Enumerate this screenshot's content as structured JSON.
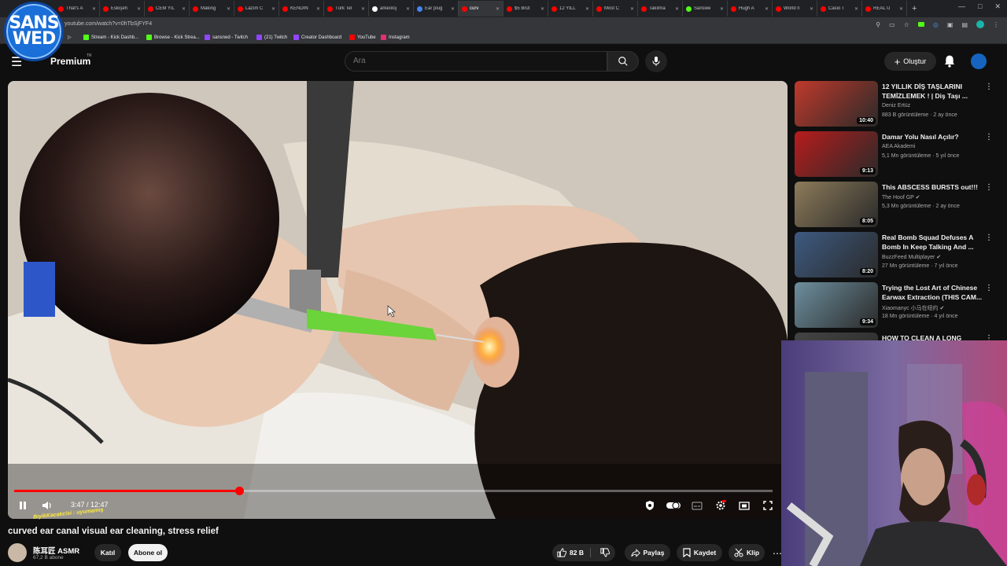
{
  "browser": {
    "tabs": [
      {
        "label": "That's A",
        "color": "#ff0000",
        "active": false
      },
      {
        "label": "Eskişeh",
        "color": "#ff0000",
        "active": false
      },
      {
        "label": "CEM YIL",
        "color": "#ff0000",
        "active": false
      },
      {
        "label": "Making",
        "color": "#ff0000",
        "active": false
      },
      {
        "label": "Lazım C",
        "color": "#ff0000",
        "active": false
      },
      {
        "label": "KENDİN",
        "color": "#ff0000",
        "active": false
      },
      {
        "label": "Türk Tel",
        "color": "#ff0000",
        "active": false
      },
      {
        "label": "arkeoloj",
        "color": "#ffffff",
        "active": false
      },
      {
        "label": "Ear plug",
        "color": "#4285f4",
        "active": false
      },
      {
        "label": "curv",
        "color": "#ff0000",
        "active": true
      },
      {
        "label": "$5 Brut",
        "color": "#ff0000",
        "active": false
      },
      {
        "label": "12 YILL",
        "color": "#ff0000",
        "active": false
      },
      {
        "label": "Most C",
        "color": "#ff0000",
        "active": false
      },
      {
        "label": "Takılma",
        "color": "#ff0000",
        "active": false
      },
      {
        "label": "Sanswe",
        "color": "#53fc18",
        "active": false
      },
      {
        "label": "Hugh A",
        "color": "#ff0000",
        "active": false
      },
      {
        "label": "World n",
        "color": "#ff0000",
        "active": false
      },
      {
        "label": "Casio T",
        "color": "#ff0000",
        "active": false
      },
      {
        "label": "REAL U",
        "color": "#ff0000",
        "active": false
      }
    ],
    "url": "youtube.com/watch?v=0hTbSjFYF4",
    "bookmarks": [
      {
        "label": "Stream - Kick Dashb...",
        "color": "#53fc18"
      },
      {
        "label": "Browse - Kick Strea...",
        "color": "#53fc18"
      },
      {
        "label": "sansned - Twitch",
        "color": "#9146ff"
      },
      {
        "label": "(21) Twitch",
        "color": "#9146ff"
      },
      {
        "label": "Creator Dashboard",
        "color": "#9146ff"
      },
      {
        "label": "YouTube",
        "color": "#ff0000"
      },
      {
        "label": "Instagram",
        "color": "#e1306c"
      }
    ]
  },
  "streamer": {
    "logo_line1": "SANS",
    "logo_line2": "WED"
  },
  "header": {
    "brand": "Premium",
    "brand_suffix": "TR",
    "search_placeholder": "Ara",
    "create_label": "Oluştur"
  },
  "player": {
    "current_time": "3:47",
    "duration": "12:47",
    "time_display": "3:47 / 12:47",
    "progress": 0.2966
  },
  "video": {
    "title": "curved ear canal visual ear cleaning, stress relief",
    "chat_overlay": "BıyikKacakcisi : uyumamış",
    "channel_name": "陈耳匠 ASMR",
    "channel_subs": "67,2 B abone",
    "join_label": "Katıl",
    "subscribe_label": "Abone ol",
    "likes": "82 B",
    "share_label": "Paylaş",
    "save_label": "Kaydet",
    "clip_label": "Klip"
  },
  "recommendations": [
    {
      "title": "12 YILLIK DİŞ TAŞLARINI TEMİZLEMEK ! | Diş Taşı ...",
      "channel": "Deniz Ertüz",
      "verified": false,
      "meta": "883 B görüntüleme · 2 ay önce",
      "duration": "10:40",
      "thumb_color": "#c0392b"
    },
    {
      "title": "Damar Yolu Nasıl Açılır?",
      "channel": "AEA Akademi",
      "verified": false,
      "meta": "5,1 Mn görüntüleme · 5 yıl önce",
      "duration": "9:13",
      "thumb_color": "#b71c1c"
    },
    {
      "title": "This ABSCESS BURSTS out!!!",
      "channel": "The Hoof GP",
      "verified": true,
      "meta": "5,3 Mn görüntüleme · 2 ay önce",
      "duration": "8:05",
      "thumb_color": "#8d7b5a"
    },
    {
      "title": "Real Bomb Squad Defuses A Bomb In Keep Talking And ...",
      "channel": "BuzzFeed Multiplayer",
      "verified": true,
      "meta": "27 Mn görüntüleme · 7 yıl önce",
      "duration": "8:20",
      "thumb_color": "#3d5a80"
    },
    {
      "title": "Trying the Lost Art of Chinese Earwax Extraction (THIS CAM...",
      "channel": "Xiaomanyc 小马在纽约",
      "verified": true,
      "meta": "18 Mn görüntüleme · 4 yıl önce",
      "duration": "9:34",
      "thumb_color": "#6d8f9e"
    },
    {
      "title": "HOW TO CLEAN A LONG HORN",
      "channel": "",
      "verified": false,
      "meta": "",
      "duration": "",
      "thumb_color": "#444444"
    }
  ]
}
